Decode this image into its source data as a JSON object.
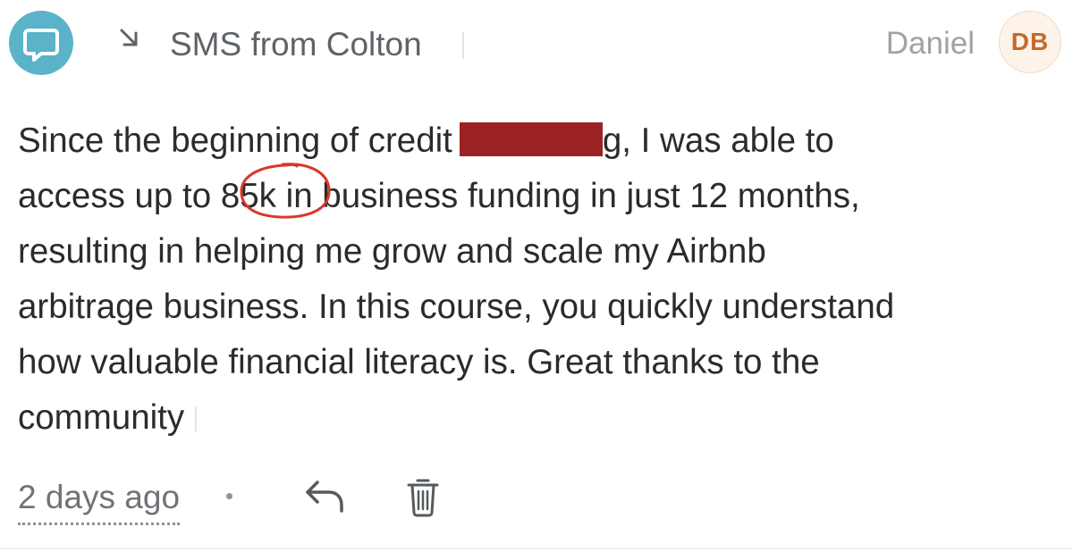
{
  "header": {
    "channel_icon": "chat-bubble-icon",
    "direction_icon": "arrow-down-right-icon",
    "title": "SMS from Colton",
    "author_name": "Daniel",
    "avatar_initials": "DB"
  },
  "message": {
    "lines": [
      {
        "before_redaction": "Since the beginning of credit",
        "after_redaction": "g, I was able to"
      },
      {
        "before_highlight": "access up to ",
        "highlight": "85k",
        "after_highlight": " in business funding in just 12 months,"
      },
      {
        "text": "resulting in helping me grow and scale my Airbnb"
      },
      {
        "text": "arbitrage business. In this course, you quickly understand"
      },
      {
        "text": "how valuable financial literacy is. Great thanks to the"
      },
      {
        "text": "community"
      }
    ],
    "redaction_color": "#9b2222",
    "highlight_circle_color": "#d8382a"
  },
  "footer": {
    "timestamp": "2 days ago",
    "separator": "•",
    "reply_icon": "reply-icon",
    "delete_icon": "trash-icon"
  },
  "colors": {
    "channel_icon_bg": "#5ab3c8",
    "avatar_bg": "#fdf3e9",
    "avatar_text": "#c46a2c",
    "body_text": "#2b2b2b",
    "muted_text": "#9ea3a7"
  }
}
